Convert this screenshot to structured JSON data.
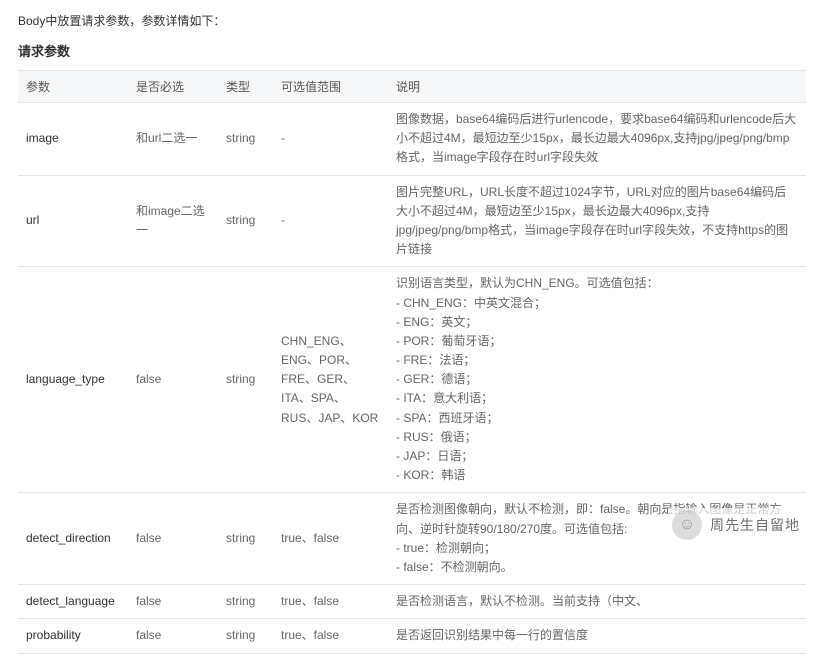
{
  "intro": "Body中放置请求参数，参数详情如下：",
  "section_title": "请求参数",
  "headers": {
    "param": "参数",
    "required": "是否必选",
    "type": "类型",
    "range": "可选值范围",
    "desc": "说明"
  },
  "rows": [
    {
      "param": "image",
      "required": "和url二选一",
      "type": "string",
      "range": "-",
      "desc": [
        "图像数据，base64编码后进行urlencode，要求base64编码和urlencode后大小不超过4M，最短边至少15px，最长边最大4096px,支持jpg/jpeg/png/bmp格式，当image字段存在时url字段失效"
      ]
    },
    {
      "param": "url",
      "required": "和image二选一",
      "type": "string",
      "range": "-",
      "desc": [
        "图片完整URL，URL长度不超过1024字节，URL对应的图片base64编码后大小不超过4M，最短边至少15px，最长边最大4096px,支持jpg/jpeg/png/bmp格式，当image字段存在时url字段失效，不支持https的图片链接"
      ]
    },
    {
      "param": "language_type",
      "required": "false",
      "type": "string",
      "range": "CHN_ENG、ENG、POR、FRE、GER、ITA、SPA、RUS、JAP、KOR",
      "desc": [
        "识别语言类型，默认为CHN_ENG。可选值包括：",
        "- CHN_ENG：中英文混合；",
        "- ENG：英文；",
        "- POR：葡萄牙语；",
        "- FRE：法语；",
        "- GER：德语；",
        "- ITA：意大利语；",
        "- SPA：西班牙语；",
        "- RUS：俄语；",
        "- JAP：日语；",
        "- KOR：韩语"
      ]
    },
    {
      "param": "detect_direction",
      "required": "false",
      "type": "string",
      "range": "true、false",
      "desc": [
        "是否检测图像朝向，默认不检测，即：false。朝向是指输入图像是正常方向、逆时针旋转90/180/270度。可选值包括:",
        "- true：检测朝向；",
        "- false：不检测朝向。"
      ]
    },
    {
      "param": "detect_language",
      "required": "false",
      "type": "string",
      "range": "true、false",
      "desc": [
        "是否检测语言，默认不检测。当前支持（中文、"
      ]
    },
    {
      "param": "probability",
      "required": "false",
      "type": "string",
      "range": "true、false",
      "desc": [
        "是否返回识别结果中每一行的置信度"
      ]
    }
  ],
  "watermark": {
    "icon": "wechat-icon",
    "text": "周先生自留地"
  }
}
